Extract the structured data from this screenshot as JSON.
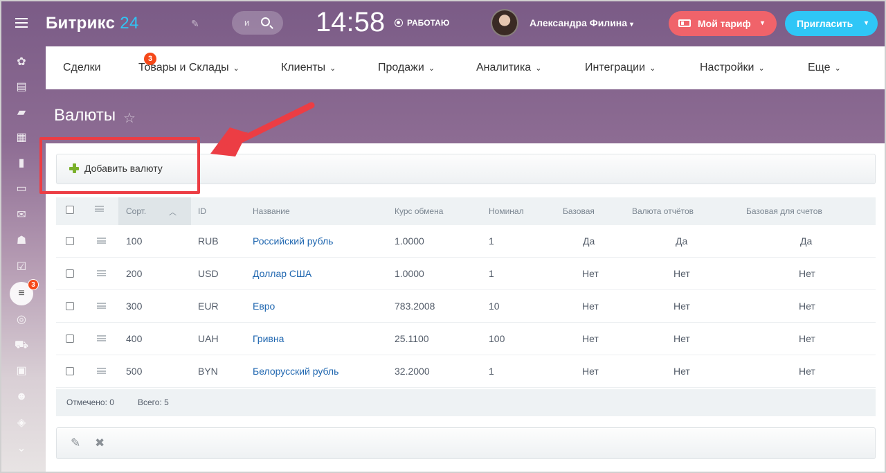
{
  "header": {
    "logo_main": "Битрикс",
    "logo_num": "24",
    "search_placeholder": "и",
    "clock": "14:58",
    "work_status": "РАБОТАЮ",
    "user_name": "Александра Филина",
    "tariff_label": "Мой тариф",
    "invite_label": "Пригласить"
  },
  "sidebar": {
    "active_badge": "3",
    "icons": [
      "activity-icon",
      "news-icon",
      "chat-icon",
      "calendar-icon",
      "document-icon",
      "drive-icon",
      "mail-icon",
      "group-icon",
      "tasks-icon",
      "crm-icon",
      "goals-icon",
      "cart-icon",
      "contact-card-icon",
      "robot-icon",
      "box-icon",
      "more-icon"
    ]
  },
  "nav": {
    "items": [
      {
        "label": "Сделки",
        "badge": "3"
      },
      {
        "label": "Товары и Склады"
      },
      {
        "label": "Клиенты"
      },
      {
        "label": "Продажи"
      },
      {
        "label": "Аналитика"
      },
      {
        "label": "Интеграции"
      },
      {
        "label": "Настройки"
      },
      {
        "label": "Еще"
      }
    ]
  },
  "page": {
    "title": "Валюты",
    "add_button": "Добавить валюту"
  },
  "grid": {
    "columns": [
      "Сорт.",
      "ID",
      "Название",
      "Курс обмена",
      "Номинал",
      "Базовая",
      "Валюта отчётов",
      "Базовая для счетов"
    ],
    "rows": [
      {
        "sort": "100",
        "id": "RUB",
        "name": "Российский рубль",
        "rate": "1.0000",
        "nominal": "1",
        "base": "Да",
        "report": "Да",
        "invoice": "Да"
      },
      {
        "sort": "200",
        "id": "USD",
        "name": "Доллар США",
        "rate": "1.0000",
        "nominal": "1",
        "base": "Нет",
        "report": "Нет",
        "invoice": "Нет"
      },
      {
        "sort": "300",
        "id": "EUR",
        "name": "Евро",
        "rate": "783.2008",
        "nominal": "10",
        "base": "Нет",
        "report": "Нет",
        "invoice": "Нет"
      },
      {
        "sort": "400",
        "id": "UAH",
        "name": "Гривна",
        "rate": "25.1100",
        "nominal": "100",
        "base": "Нет",
        "report": "Нет",
        "invoice": "Нет"
      },
      {
        "sort": "500",
        "id": "BYN",
        "name": "Белорусский рубль",
        "rate": "32.2000",
        "nominal": "1",
        "base": "Нет",
        "report": "Нет",
        "invoice": "Нет"
      }
    ],
    "footer_selected": "Отмечено: 0",
    "footer_total": "Всего: 5"
  },
  "colors": {
    "accent_blue": "#2fc6f6",
    "tariff_red": "#f0636a",
    "highlight_red": "#ec3d44",
    "link_blue": "#2067b0"
  }
}
